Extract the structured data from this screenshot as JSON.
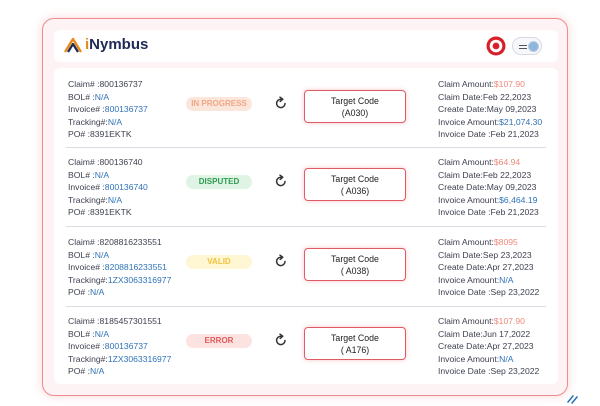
{
  "header": {
    "brand": "iNymbus",
    "brand_prefix": "i",
    "brand_rest": "Nymbus"
  },
  "labels": {
    "claim": "Claim# :",
    "bol": "BOL# :",
    "invoice": "Invoice# :",
    "tracking": "Tracking#:",
    "po": "PO# :",
    "claim_amount": "Claim Amount:",
    "claim_date": "Claim Date:",
    "create_date": "Create Date:",
    "invoice_amount": "Invoice Amount:",
    "invoice_date": "Invoice Date :"
  },
  "colors": {
    "accent": "#e05a66",
    "link_blue": "#2f73b8",
    "amount_orange": "#ee8a7a"
  },
  "claims": [
    {
      "claim": "800136737",
      "bol": "N/A",
      "invoice": "800136737",
      "tracking": "N/A",
      "po": "8391EKTK",
      "status": "IN PROGRESS",
      "code_title": "Target Code",
      "code_value": "(A030)",
      "claim_amount": "$107.90",
      "claim_date": "Feb 22,2023",
      "create_date": "May 09,2023",
      "invoice_amount": "$21,074.30",
      "invoice_date": "Feb 21,2023"
    },
    {
      "claim": "800136740",
      "bol": "N/A",
      "invoice": "800136740",
      "tracking": "N/A",
      "po": "8391EKTK",
      "status": "DISPUTED",
      "code_title": "Target Code",
      "code_value": "( A036)",
      "claim_amount": "$64.94",
      "claim_date": "Feb 22,2023",
      "create_date": "May 09,2023",
      "invoice_amount": "$6,464.19",
      "invoice_date": "Feb 21,2023"
    },
    {
      "claim": "8208816233551",
      "bol": "N/A",
      "invoice": "8208816233551",
      "tracking": "1ZX3063316977",
      "po": "N/A",
      "status": "VALID",
      "code_title": "Target Code",
      "code_value": "( A038)",
      "claim_amount": "$8095",
      "claim_date": "Sep 23,2023",
      "create_date": "Apr 27,2023",
      "invoice_amount": "N/A",
      "invoice_date": "Sep 23,2022"
    },
    {
      "claim": "8185457301551",
      "bol": "N/A",
      "invoice": "800136737",
      "tracking": "1ZX3063316977",
      "po": "N/A",
      "status": "ERROR",
      "code_title": "Target Code",
      "code_value": "( A176)",
      "claim_amount": "$107.90",
      "claim_date": "Jun 17,2022",
      "create_date": "Apr 27,2023",
      "invoice_amount": "N/A",
      "invoice_date": "Sep 23,2022"
    }
  ]
}
